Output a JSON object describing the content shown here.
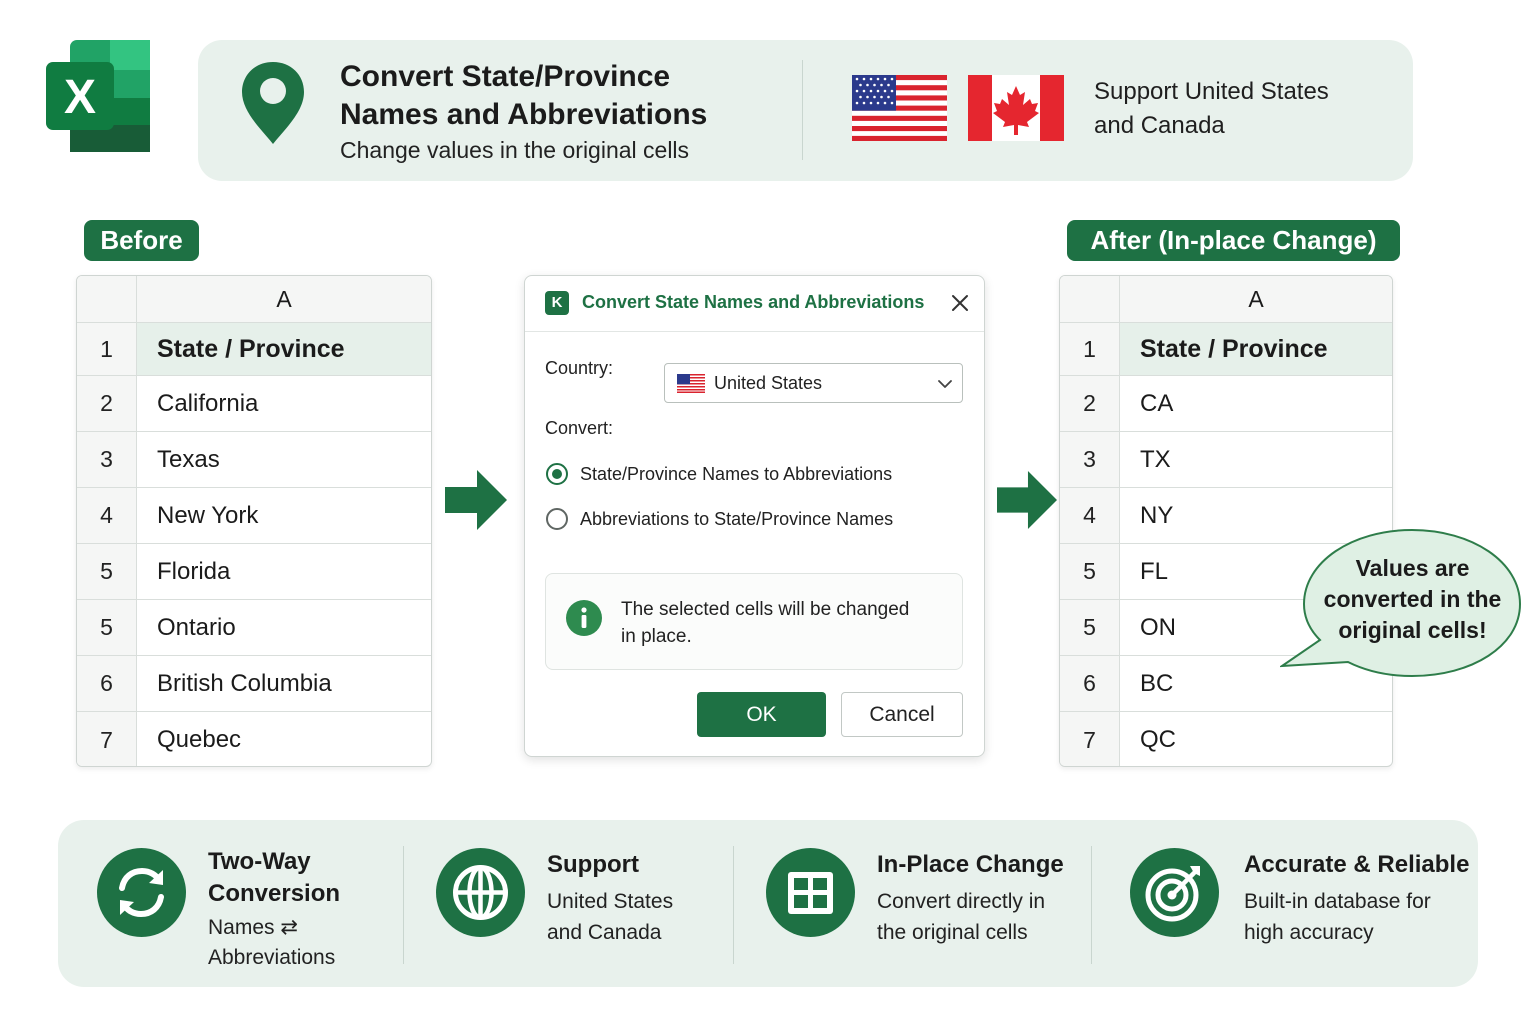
{
  "header": {
    "title_line1": "Convert State/Province",
    "title_line2": "Names and Abbreviations",
    "subtitle": "Change values in the original cells",
    "support_line1": "Support United States",
    "support_line2": "and Canada"
  },
  "before": {
    "label": "Before",
    "column_header": "A",
    "rows": [
      {
        "num": "1",
        "value": "State / Province"
      },
      {
        "num": "2",
        "value": "California"
      },
      {
        "num": "3",
        "value": "Texas"
      },
      {
        "num": "4",
        "value": "New York"
      },
      {
        "num": "5",
        "value": "Florida"
      },
      {
        "num": "5",
        "value": "Ontario"
      },
      {
        "num": "6",
        "value": "British Columbia"
      },
      {
        "num": "7",
        "value": "Quebec"
      }
    ]
  },
  "after": {
    "label": "After  (In-place Change)",
    "column_header": "A",
    "rows": [
      {
        "num": "1",
        "value": "State / Province"
      },
      {
        "num": "2",
        "value": "CA"
      },
      {
        "num": "3",
        "value": "TX"
      },
      {
        "num": "4",
        "value": "NY"
      },
      {
        "num": "5",
        "value": "FL"
      },
      {
        "num": "5",
        "value": "ON"
      },
      {
        "num": "6",
        "value": "BC"
      },
      {
        "num": "7",
        "value": "QC"
      }
    ]
  },
  "dialog": {
    "logo_letter": "K",
    "title": "Convert State Names and Abbreviations",
    "country_label": "Country:",
    "country_value": "United States",
    "convert_label": "Convert:",
    "option1": "State/Province Names to Abbreviations",
    "option2": "Abbreviations to State/Province Names",
    "selected_option": 1,
    "info_line1": "The selected cells will be changed",
    "info_line2": "in place.",
    "ok_label": "OK",
    "cancel_label": "Cancel"
  },
  "bubble": {
    "line1": "Values are",
    "line2": "converted in the",
    "line3": "original cells!"
  },
  "features": [
    {
      "title_line1": "Two-Way",
      "title_line2": "Conversion",
      "desc_line1": "Names ⇄",
      "desc_line2": "Abbreviations",
      "icon": "sync-arrows-icon"
    },
    {
      "title_line1": "Support",
      "desc_line1": "United States",
      "desc_line2": "and Canada",
      "icon": "globe-icon"
    },
    {
      "title_line1": "In-Place Change",
      "desc_line1": "Convert directly in",
      "desc_line2": "the original cells",
      "icon": "grid-icon"
    },
    {
      "title_line1": "Accurate & Reliable",
      "desc_line1": "Built-in database for",
      "desc_line2": "high accuracy",
      "icon": "target-icon"
    }
  ],
  "colors": {
    "brand_green": "#1e7144",
    "panel_tint": "#e8f1ec",
    "bubble_fill": "#dff0e4"
  },
  "logo": {
    "letter": "X"
  }
}
